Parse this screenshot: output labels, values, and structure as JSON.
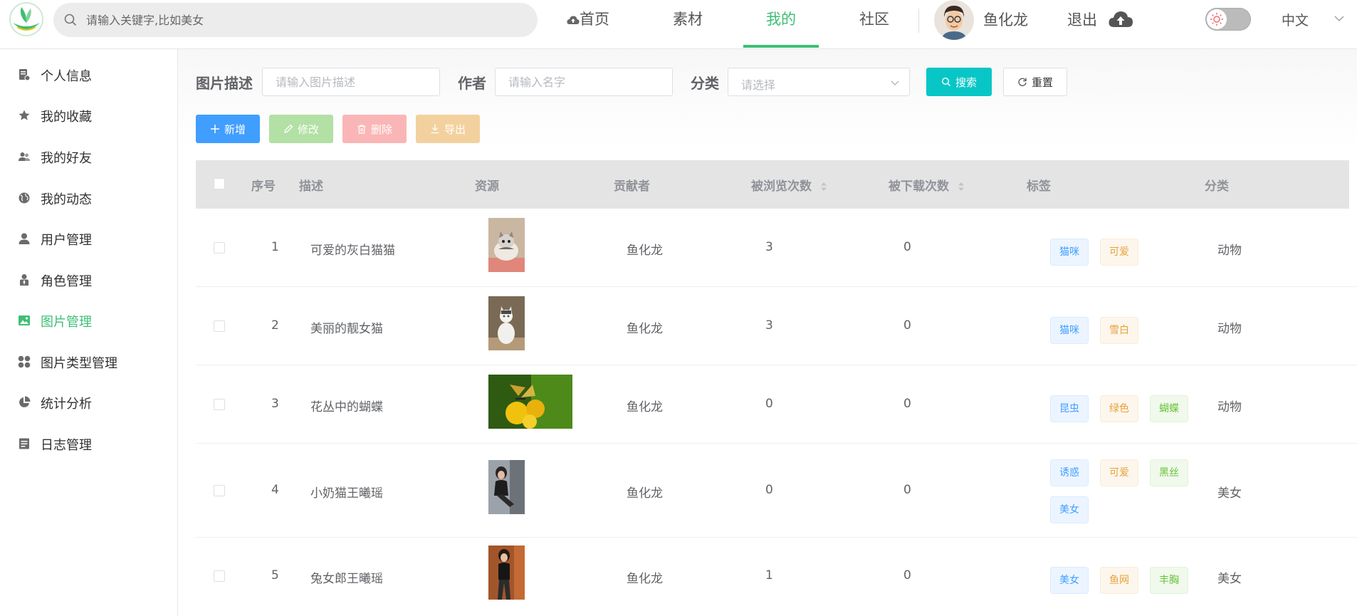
{
  "header": {
    "search_placeholder": "请输入关键字,比如美女",
    "nav": [
      "首页",
      "素材",
      "我的",
      "社区"
    ],
    "active_nav": "我的",
    "user_name": "鱼化龙",
    "logout_label": "退出",
    "lang_label": "中文",
    "accent_color": "#3dbf74"
  },
  "sidebar": {
    "items": [
      {
        "label": "个人信息",
        "icon": "id-card-icon"
      },
      {
        "label": "我的收藏",
        "icon": "star-icon"
      },
      {
        "label": "我的好友",
        "icon": "friends-icon"
      },
      {
        "label": "我的动态",
        "icon": "globe-icon"
      },
      {
        "label": "用户管理",
        "icon": "user-icon"
      },
      {
        "label": "角色管理",
        "icon": "role-icon"
      },
      {
        "label": "图片管理",
        "icon": "picture-icon",
        "active": true
      },
      {
        "label": "图片类型管理",
        "icon": "grid-icon"
      },
      {
        "label": "统计分析",
        "icon": "pie-chart-icon"
      },
      {
        "label": "日志管理",
        "icon": "log-icon"
      }
    ]
  },
  "filters": {
    "desc_label": "图片描述",
    "desc_placeholder": "请输入图片描述",
    "author_label": "作者",
    "author_placeholder": "请输入名字",
    "category_label": "分类",
    "category_placeholder": "请选择",
    "search_label": "搜索",
    "reset_label": "重置"
  },
  "actions": {
    "add_label": "新增",
    "edit_label": "修改",
    "delete_label": "删除",
    "export_label": "导出"
  },
  "table": {
    "columns": {
      "index": "序号",
      "desc": "描述",
      "resource": "资源",
      "contributor": "贡献者",
      "views": "被浏览次数",
      "downloads": "被下载次数",
      "tags": "标签",
      "category": "分类"
    },
    "rows": [
      {
        "index": "1",
        "desc": "可爱的灰白猫猫",
        "contributor": "鱼化龙",
        "views": "3",
        "downloads": "0",
        "tags": [
          {
            "text": "猫咪",
            "color": "blue"
          },
          {
            "text": "可爱",
            "color": "orange"
          }
        ],
        "category": "动物"
      },
      {
        "index": "2",
        "desc": "美丽的靓女猫",
        "contributor": "鱼化龙",
        "views": "3",
        "downloads": "0",
        "tags": [
          {
            "text": "猫咪",
            "color": "blue"
          },
          {
            "text": "雪白",
            "color": "orange"
          }
        ],
        "category": "动物"
      },
      {
        "index": "3",
        "desc": "花丛中的蝴蝶",
        "contributor": "鱼化龙",
        "views": "0",
        "downloads": "0",
        "tags": [
          {
            "text": "昆虫",
            "color": "blue"
          },
          {
            "text": "绿色",
            "color": "orange"
          },
          {
            "text": "蝴蝶",
            "color": "green"
          }
        ],
        "category": "动物"
      },
      {
        "index": "4",
        "desc": "小奶猫王曦瑶",
        "contributor": "鱼化龙",
        "views": "0",
        "downloads": "0",
        "tags": [
          {
            "text": "诱惑",
            "color": "blue"
          },
          {
            "text": "可爱",
            "color": "orange"
          },
          {
            "text": "黑丝",
            "color": "green"
          },
          {
            "text": "美女",
            "color": "blue"
          }
        ],
        "category": "美女"
      },
      {
        "index": "5",
        "desc": "兔女郎王曦瑶",
        "contributor": "鱼化龙",
        "views": "1",
        "downloads": "0",
        "tags": [
          {
            "text": "美女",
            "color": "blue"
          },
          {
            "text": "鱼网",
            "color": "orange"
          },
          {
            "text": "丰胸",
            "color": "green"
          }
        ],
        "category": "美女"
      }
    ]
  }
}
